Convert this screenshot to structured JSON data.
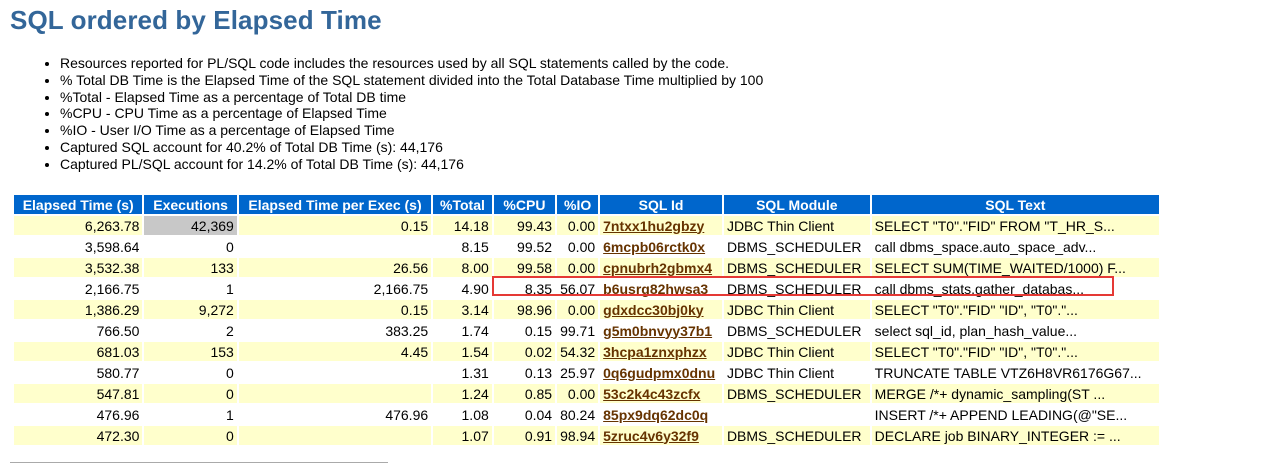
{
  "title": "SQL ordered by Elapsed Time",
  "notes": [
    "Resources reported for PL/SQL code includes the resources used by all SQL statements called by the code.",
    "% Total DB Time is the Elapsed Time of the SQL statement divided into the Total Database Time multiplied by 100",
    "%Total - Elapsed Time as a percentage of Total DB time",
    "%CPU - CPU Time as a percentage of Elapsed Time",
    "%IO - User I/O Time as a percentage of Elapsed Time",
    "Captured SQL account for 40.2% of Total DB Time (s): 44,176",
    "Captured PL/SQL account for 14.2% of Total DB Time (s): 44,176"
  ],
  "table": {
    "headers": [
      "Elapsed Time (s)",
      "Executions",
      "Elapsed Time per Exec (s)",
      "%Total",
      "%CPU",
      "%IO",
      "SQL Id",
      "SQL Module",
      "SQL Text"
    ],
    "rows": [
      {
        "elapsed": "6,263.78",
        "executions": "42,369",
        "per_exec": "0.15",
        "total": "14.18",
        "cpu": "99.43",
        "io": "0.00",
        "sql_id": "7ntxx1hu2gbzy",
        "module": "JDBC Thin Client",
        "text": "SELECT \"T0\".\"FID\" FROM \"T_HR_S..."
      },
      {
        "elapsed": "3,598.64",
        "executions": "0",
        "per_exec": "",
        "total": "8.15",
        "cpu": "99.52",
        "io": "0.00",
        "sql_id": "6mcpb06rctk0x",
        "module": "DBMS_SCHEDULER",
        "text": "call dbms_space.auto_space_adv..."
      },
      {
        "elapsed": "3,532.38",
        "executions": "133",
        "per_exec": "26.56",
        "total": "8.00",
        "cpu": "99.58",
        "io": "0.00",
        "sql_id": "cpnubrh2gbmx4",
        "module": "DBMS_SCHEDULER",
        "text": "SELECT SUM(TIME_WAITED/1000) F..."
      },
      {
        "elapsed": "2,166.75",
        "executions": "1",
        "per_exec": "2,166.75",
        "total": "4.90",
        "cpu": "8.35",
        "io": "56.07",
        "sql_id": "b6usrg82hwsa3",
        "module": "DBMS_SCHEDULER",
        "text": "call dbms_stats.gather_databas..."
      },
      {
        "elapsed": "1,386.29",
        "executions": "9,272",
        "per_exec": "0.15",
        "total": "3.14",
        "cpu": "98.96",
        "io": "0.00",
        "sql_id": "gdxdcc30bj0ky",
        "module": "JDBC Thin Client",
        "text": "SELECT \"T0\".\"FID\" \"ID\", \"T0\".\"..."
      },
      {
        "elapsed": "766.50",
        "executions": "2",
        "per_exec": "383.25",
        "total": "1.74",
        "cpu": "0.15",
        "io": "99.71",
        "sql_id": "g5m0bnvyy37b1",
        "module": "DBMS_SCHEDULER",
        "text": "select sql_id, plan_hash_value..."
      },
      {
        "elapsed": "681.03",
        "executions": "153",
        "per_exec": "4.45",
        "total": "1.54",
        "cpu": "0.02",
        "io": "54.32",
        "sql_id": "3hcpa1znxphzx",
        "module": "JDBC Thin Client",
        "text": "SELECT \"T0\".\"FID\" \"ID\", \"T0\".\"..."
      },
      {
        "elapsed": "580.77",
        "executions": "0",
        "per_exec": "",
        "total": "1.31",
        "cpu": "0.13",
        "io": "25.97",
        "sql_id": "0q6gudpmx0dnu",
        "module": "JDBC Thin Client",
        "text": "TRUNCATE TABLE VTZ6H8VR6176G67..."
      },
      {
        "elapsed": "547.81",
        "executions": "0",
        "per_exec": "",
        "total": "1.24",
        "cpu": "0.85",
        "io": "0.00",
        "sql_id": "53c2k4c43zcfx",
        "module": "DBMS_SCHEDULER",
        "text": "MERGE /*+ dynamic_sampling(ST ..."
      },
      {
        "elapsed": "476.96",
        "executions": "1",
        "per_exec": "476.96",
        "total": "1.08",
        "cpu": "0.04",
        "io": "80.24",
        "sql_id": "85px9dq62dc0q",
        "module": "",
        "text": "INSERT /*+ APPEND LEADING(@\"SE..."
      },
      {
        "elapsed": "472.30",
        "executions": "0",
        "per_exec": "",
        "total": "1.07",
        "cpu": "0.91",
        "io": "98.94",
        "sql_id": "5zruc4v6y32f9",
        "module": "DBMS_SCHEDULER",
        "text": "DECLARE job BINARY_INTEGER := ..."
      }
    ]
  },
  "colors": {
    "title": "#336699",
    "header_bg": "#0066cc",
    "row_odd_bg": "#ffffcc",
    "sql_id_link": "#663300",
    "highlight_border": "#e53935"
  }
}
